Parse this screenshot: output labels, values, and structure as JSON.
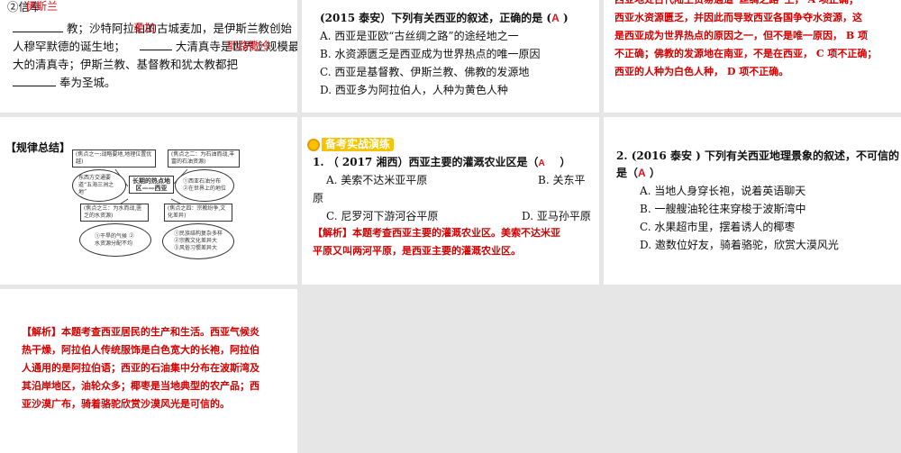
{
  "slide1": {
    "circle_num": "②",
    "line0": "信奉",
    "ans1": "伊斯兰",
    "line1": "教；沙特阿拉伯的古城麦加，是伊斯兰教创始",
    "ans2": "麦加",
    "line2a": "人穆罕默德的诞生地；",
    "line2b": "大清真寺是世界上规模最",
    "ans3": "耶路撒冷",
    "line3": "大的清真寺；伊斯兰教、基督教和犹太教都把",
    "line4": "奉为圣城。"
  },
  "slide2": {
    "question_prefix": "(2015 泰安）下列有关西亚的叙述，正确的是 (",
    "answer": "A",
    "question_suffix": ")",
    "options": [
      "A. 西亚是亚欧“古丝绸之路”的途经地之一",
      "B. 水资源匮乏是西亚成为世界热点的唯一原因",
      "C. 西亚是基督教、伊斯兰教、佛教的发源地",
      "D. 西亚多为阿拉伯人，人种为黄色人种"
    ]
  },
  "slide3": {
    "lines": [
      "西亚地处古代陆上贸易通道“丝绸之路”上， A 项正确；",
      "西亚水资源匮乏，并因此而导致西亚各国争夺水资源，这",
      "是西亚成为世界热点的原因之一，但不是唯一原因，  B 项",
      "不正确；佛教的发源地在南亚，不是在西亚， C 项不正确；",
      "西亚的人种为白色人种， D 项不正确。"
    ]
  },
  "slide4": {
    "heading": "【规律总结】",
    "center": "长期的热点地区——西亚",
    "focus1": "(焦点之一:战略要地,地理位置优越)",
    "focus2": "(焦点之二：为石油而战,丰富的石油资源)",
    "focus3": "(焦点之三：为水而战,匮乏的水资源)",
    "focus4": "(焦点之四：宗教纷争,文化差异)",
    "ell1": "东西方交通要道“五海三洲之地”",
    "ell2": "①西亚石油分布 ②在世界上的地位",
    "ell3": "①干旱的气候 ②水资源分配不均",
    "ell4": "①民族结构复杂多样 ②宗教文化差异大 ③风俗习惯差异大"
  },
  "slide5": {
    "banner": "备考实战演练",
    "question": "1. （ 2017 湘西）西亚主要的灌溉农业区是（",
    "answer": "A",
    "question_suffix": "）",
    "optA": "A. 美索不达米亚平原",
    "optB": "B. 关东平",
    "optB_wrap": "原",
    "optC": "C. 尼罗河下游河谷平原",
    "optD": "D. 亚马孙平原",
    "analysis_lines": [
      "【解析】本题考查西亚主要的灌溉农业区。美索不达米亚",
      "平原又叫两河平原，是西亚主要的灌溉农业区。"
    ]
  },
  "slide6": {
    "question": "2.    (2016 泰安 ) 下列有关西亚地理景象的叙述，不可信的",
    "line2_prefix": "是（",
    "answer": "A",
    "line2_suffix": "）",
    "options": [
      "A. 当地人身穿长袍，说着英语聊天",
      "B. 一艘艘油轮往来穿梭于波斯湾中",
      "C. 水果超市里，摆着诱人的椰枣",
      "D. 邀数位好友，骑着骆驼，欣赏大漠风光"
    ]
  },
  "slide7": {
    "lines": [
      "【解析】本题考查西亚居民的生产和生活。西亚气候炎",
      "热干燥，阿拉伯人传统服饰是白色宽大的长袍，阿拉伯",
      "人通用的是阿拉伯语；西亚的石油集中分布在波斯湾及",
      "其沿岸地区，油轮众多；椰枣是当地典型的农产品；西",
      "亚沙漠广布，骑着骆驼欣赏沙漠风光是可信的。"
    ]
  }
}
